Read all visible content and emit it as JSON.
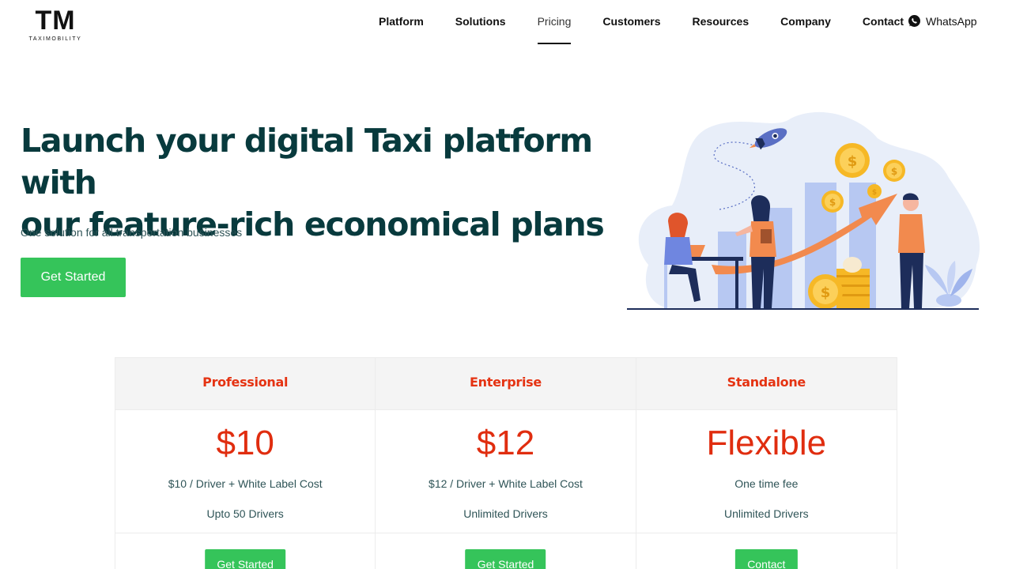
{
  "logo": {
    "mark": "TM",
    "sub": "TAXIMOBILITY"
  },
  "nav": {
    "items": [
      {
        "label": "Platform",
        "active": false
      },
      {
        "label": "Solutions",
        "active": false
      },
      {
        "label": "Pricing",
        "active": true
      },
      {
        "label": "Customers",
        "active": false
      },
      {
        "label": "Resources",
        "active": false
      },
      {
        "label": "Company",
        "active": false
      },
      {
        "label": "Contact",
        "active": false
      }
    ],
    "whatsapp_label": "WhatsApp"
  },
  "hero": {
    "title_line1": "Launch your digital Taxi platform with",
    "title_line2": "our feature-rich economical plans",
    "subtitle": "One solution for all transportation businesses",
    "cta_label": "Get Started"
  },
  "plans": [
    {
      "name": "Professional",
      "price": "$10",
      "line1": "$10 / Driver + White Label Cost",
      "line2": "Upto 50 Drivers",
      "button": "Get Started"
    },
    {
      "name": "Enterprise",
      "price": "$12",
      "line1": "$12 / Driver + White Label Cost",
      "line2": "Unlimited Drivers",
      "button": "Get Started"
    },
    {
      "name": "Standalone",
      "price": "Flexible",
      "line1": "One time fee",
      "line2": "Unlimited Drivers",
      "button": "Contact"
    }
  ],
  "colors": {
    "accent_green": "#35c45a",
    "price_red": "#e02d0f",
    "heading_dark": "#083a3d"
  },
  "icons": {
    "whatsapp": "whatsapp-icon",
    "illustration": "growth-illustration"
  }
}
